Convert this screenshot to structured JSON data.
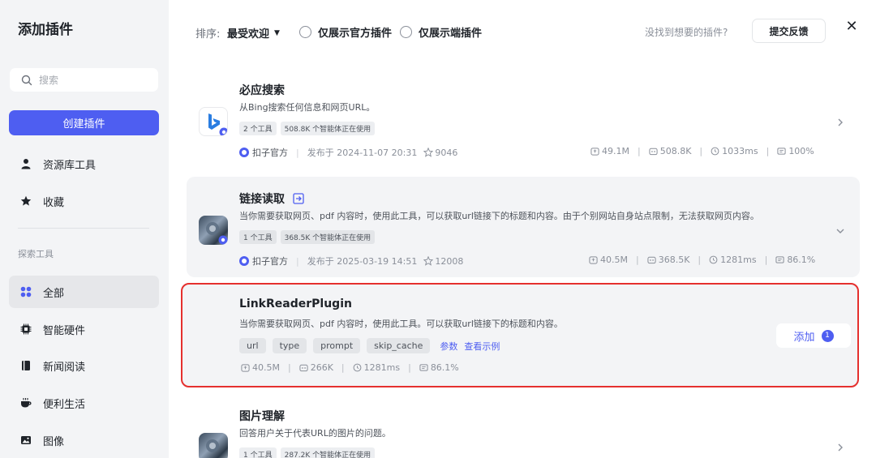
{
  "sidebar": {
    "title": "添加插件",
    "search_placeholder": "搜索",
    "create_button": "创建插件",
    "items_top": [
      {
        "label": "资源库工具",
        "icon": "person-icon"
      },
      {
        "label": "收藏",
        "icon": "star-icon"
      }
    ],
    "section_label": "探索工具",
    "items": [
      {
        "label": "全部",
        "icon": "grid-icon",
        "active": true
      },
      {
        "label": "智能硬件",
        "icon": "chip-icon"
      },
      {
        "label": "新闻阅读",
        "icon": "book-icon"
      },
      {
        "label": "便利生活",
        "icon": "coffee-icon"
      },
      {
        "label": "图像",
        "icon": "image-icon"
      }
    ]
  },
  "topbar": {
    "sort_label": "排序:",
    "sort_value": "最受欢迎",
    "filter_official": "仅展示官方插件",
    "filter_client": "仅展示端插件",
    "hint": "没找到想要的插件?",
    "feedback_button": "提交反馈",
    "close": "✕"
  },
  "plugins": [
    {
      "title": "必应搜索",
      "desc": "从Bing搜索任何信息和网页URL。",
      "tags": [
        "2 个工具",
        "508.8K 个智能体正在使用"
      ],
      "official": "扣子官方",
      "published": "发布于 2024-11-07 20:31",
      "stars": "9046",
      "stats": [
        "49.1M",
        "508.8K",
        "1033ms",
        "100%"
      ]
    },
    {
      "title": "链接读取",
      "desc": "当你需要获取网页、pdf 内容时，使用此工具，可以获取url链接下的标题和内容。由于个别网站自身站点限制，无法获取网页内容。",
      "tags": [
        "1 个工具",
        "368.5K 个智能体正在使用"
      ],
      "official": "扣子官方",
      "published": "发布于 2025-03-19 14:51",
      "stars": "12008",
      "stats": [
        "40.5M",
        "368.5K",
        "1281ms",
        "86.1%"
      ]
    },
    {
      "title": "图片理解",
      "desc": "回答用户关于代表URL的图片的问题。",
      "tags": [
        "1 个工具",
        "287.2K 个智能体正在使用"
      ]
    }
  ],
  "tool": {
    "title": "LinkReaderPlugin",
    "desc": "当你需要获取网页、pdf 内容时，使用此工具。可以获取url链接下的标题和内容。",
    "params": [
      "url",
      "type",
      "prompt",
      "skip_cache"
    ],
    "params_link": "参数",
    "example_link": "查看示例",
    "stats": [
      "40.5M",
      "266K",
      "1281ms",
      "86.1%"
    ],
    "add_button": "添加",
    "add_count": "1"
  },
  "colors": {
    "accent": "#4e5ef1",
    "selected_border": "#e5302e"
  }
}
